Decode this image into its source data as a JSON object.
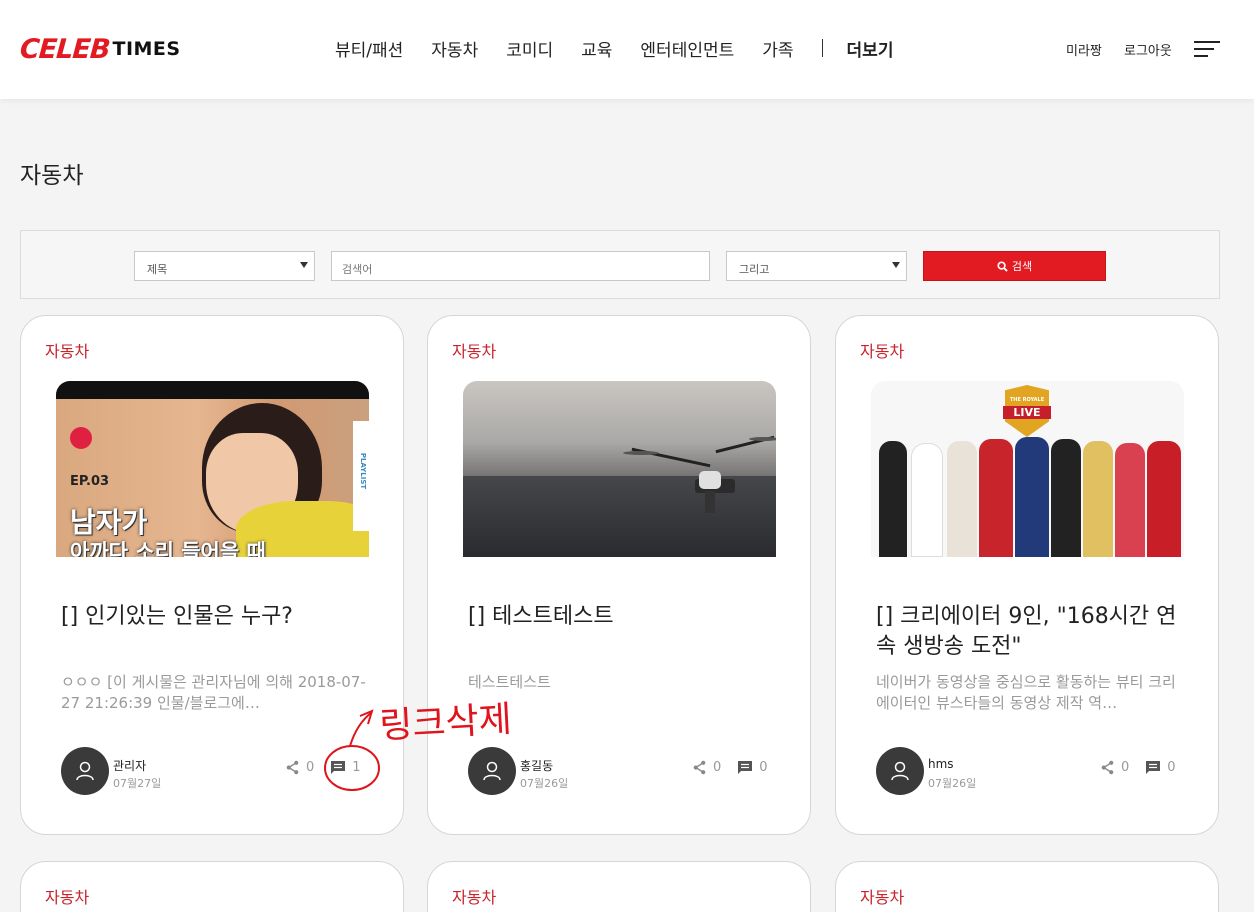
{
  "header": {
    "logo_left": "CELEB",
    "logo_right": "TIMES",
    "nav": [
      "뷰티/패션",
      "자동차",
      "코미디",
      "교육",
      "엔터테인먼트",
      "가족"
    ],
    "nav_more": "더보기",
    "user": "미라짱",
    "logout": "로그아웃"
  },
  "page_title": "자동차",
  "search": {
    "field_select": "제목",
    "placeholder": "검색어",
    "operator_select": "그리고",
    "button_label": "검색"
  },
  "cards": [
    {
      "category": "자동차",
      "thumb_text_ep": "EP.03",
      "thumb_text_big": "남자가",
      "thumb_text_sub": "아까다 소리 들어을 때",
      "thumb_side": "PLAYLIST",
      "title": "[] 인기있는 인물은 누구?",
      "excerpt": "ㅇㅇㅇ [이 게시물은 관리자님에 의해 2018-07-27 21:26:39 인물/블로그에…",
      "author": "관리자",
      "date": "07월27일",
      "shares": "0",
      "comments": "1"
    },
    {
      "category": "자동차",
      "title": "[] 테스트테스트",
      "excerpt": "테스트테스트",
      "author": "홍길동",
      "date": "07월26일",
      "shares": "0",
      "comments": "0"
    },
    {
      "category": "자동차",
      "thumb_badge_top": "THE ROYALE",
      "thumb_badge": "LIVE",
      "title": "[] 크리에이터 9인, \"168시간 연속 생방송 도전\"",
      "excerpt": "네이버가 동영상을 중심으로 활동하는 뷰티 크리에이터인 뷰스타들의 동영상 제작 역…",
      "author": "hms",
      "date": "07월26일",
      "shares": "0",
      "comments": "0"
    }
  ],
  "bottom_cards": [
    "자동차",
    "자동차",
    "자동차"
  ],
  "annotation_text": "링크삭제",
  "colors": {
    "brand": "#e21b23",
    "category": "#c8242c",
    "annotation": "#e0141c"
  }
}
